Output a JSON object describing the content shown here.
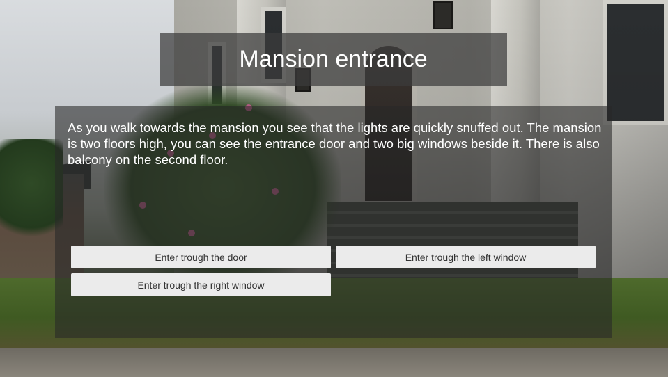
{
  "scene": {
    "title": "Mansion entrance",
    "description": "As you walk towards the mansion you see that the lights are quickly snuffed out. The mansion is two floors high, you can see the entrance door and two big windows beside it. There is also balcony on the second floor."
  },
  "choices": [
    {
      "label": "Enter trough the door"
    },
    {
      "label": "Enter trough the left window"
    },
    {
      "label": "Enter trough the right window"
    }
  ],
  "colors": {
    "panel": "#3c3c3c",
    "button": "#ebebeb",
    "button_text": "#323232",
    "text": "#ffffff"
  }
}
